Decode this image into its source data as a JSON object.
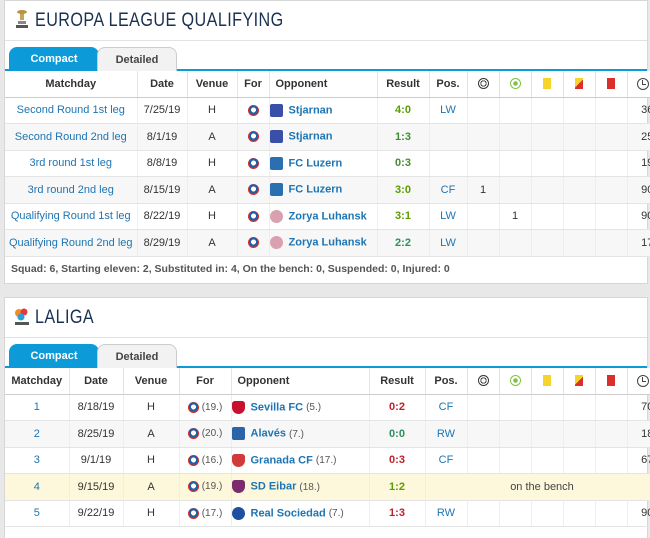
{
  "section1": {
    "title": "EUROPA LEAGUE QUALIFYING",
    "tabs": {
      "compact": "Compact",
      "detailed": "Detailed"
    },
    "headers": {
      "matchday": "Matchday",
      "date": "Date",
      "venue": "Venue",
      "for": "For",
      "opponent": "Opponent",
      "result": "Result",
      "pos": "Pos."
    },
    "rows": [
      {
        "matchday": "Second Round 1st leg",
        "date": "7/25/19",
        "venue": "H",
        "opponent": "Stjarnan",
        "result": "4:0",
        "pos": "LW",
        "goals": "",
        "assists": "",
        "minutes": "36'"
      },
      {
        "matchday": "Second Round 2nd leg",
        "date": "8/1/19",
        "venue": "A",
        "opponent": "Stjarnan",
        "result": "1:3",
        "pos": "",
        "goals": "",
        "assists": "",
        "minutes": "25'"
      },
      {
        "matchday": "3rd round 1st leg",
        "date": "8/8/19",
        "venue": "H",
        "opponent": "FC Luzern",
        "result": "0:3",
        "pos": "",
        "goals": "",
        "assists": "",
        "minutes": "19'"
      },
      {
        "matchday": "3rd round 2nd leg",
        "date": "8/15/19",
        "venue": "A",
        "opponent": "FC Luzern",
        "result": "3:0",
        "pos": "CF",
        "goals": "1",
        "assists": "",
        "minutes": "90'"
      },
      {
        "matchday": "Qualifying Round 1st leg",
        "date": "8/22/19",
        "venue": "H",
        "opponent": "Zorya Luhansk",
        "result": "3:1",
        "pos": "LW",
        "goals": "",
        "assists": "1",
        "minutes": "90'"
      },
      {
        "matchday": "Qualifying Round 2nd leg",
        "date": "8/29/19",
        "venue": "A",
        "opponent": "Zorya Luhansk",
        "result": "2:2",
        "pos": "LW",
        "goals": "",
        "assists": "",
        "minutes": "17'"
      }
    ],
    "summary": "Squad: 6, Starting eleven: 2, Substituted in: 4, On the bench: 0, Suspended: 0, Injured: 0"
  },
  "section2": {
    "title": "LALIGA",
    "tabs": {
      "compact": "Compact",
      "detailed": "Detailed"
    },
    "headers": {
      "matchday": "Matchday",
      "date": "Date",
      "venue": "Venue",
      "for": "For",
      "opponent": "Opponent",
      "result": "Result",
      "pos": "Pos."
    },
    "rows": [
      {
        "matchday": "1",
        "date": "8/18/19",
        "venue": "H",
        "for_rank": "(19.)",
        "opponent": "Sevilla FC",
        "opp_rank": "(5.)",
        "result": "0:2",
        "pos": "CF",
        "minutes": "70'"
      },
      {
        "matchday": "2",
        "date": "8/25/19",
        "venue": "A",
        "for_rank": "(20.)",
        "opponent": "Alavés",
        "opp_rank": "(7.)",
        "result": "0:0",
        "pos": "RW",
        "minutes": "18'"
      },
      {
        "matchday": "3",
        "date": "9/1/19",
        "venue": "H",
        "for_rank": "(16.)",
        "opponent": "Granada CF",
        "opp_rank": "(17.)",
        "result": "0:3",
        "pos": "CF",
        "minutes": "67'"
      },
      {
        "matchday": "4",
        "date": "9/15/19",
        "venue": "A",
        "for_rank": "(19.)",
        "opponent": "SD Eibar",
        "opp_rank": "(18.)",
        "result": "1:2",
        "bench": "on the bench"
      },
      {
        "matchday": "5",
        "date": "9/22/19",
        "venue": "H",
        "for_rank": "(17.)",
        "opponent": "Real Sociedad",
        "opp_rank": "(7.)",
        "result": "1:3",
        "pos": "RW",
        "minutes": "90'"
      }
    ]
  },
  "icons": {
    "goals": "ball-icon",
    "assists": "assist-icon",
    "yellow": "yellow-card-icon",
    "yellow_red": "yellow-red-card-icon",
    "red": "red-card-icon",
    "minutes": "clock-icon"
  },
  "colors": {
    "accent": "#0d9ad9",
    "title": "#1a3151",
    "link": "#1d75b3",
    "win": "#5a9e00",
    "loss": "#c0202c"
  }
}
